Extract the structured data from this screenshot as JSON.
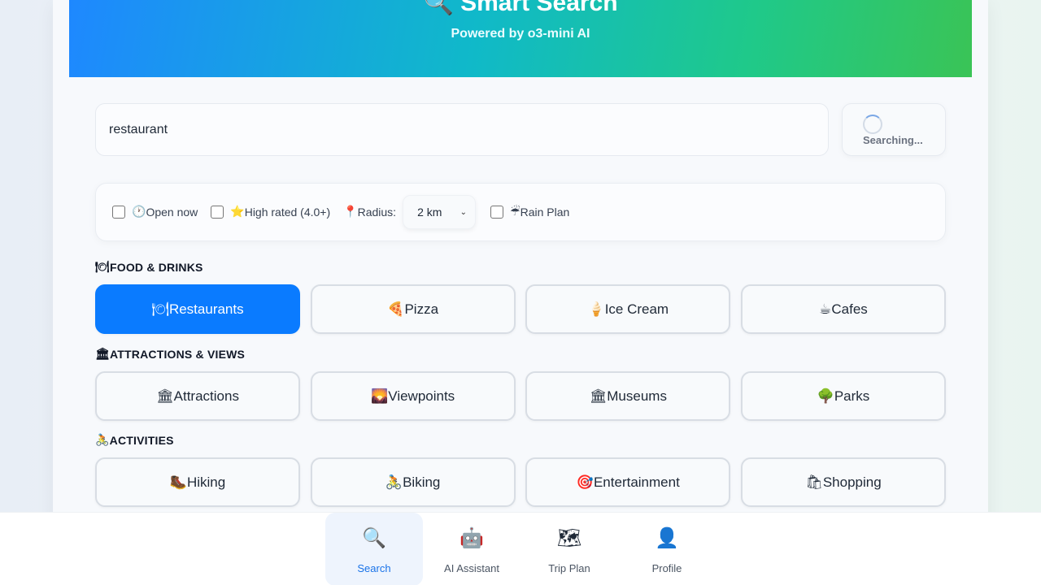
{
  "hero": {
    "title": "🔍 Smart Search",
    "subtitle": "Powered by o3-mini AI",
    "gradient_colors": [
      "#1e88ff",
      "#10b9c9",
      "#3ac456"
    ]
  },
  "search": {
    "value": "restaurant",
    "button_label": "Searching..."
  },
  "filters": {
    "open_now": {
      "icon": "🕐",
      "label": "Open now",
      "checked": false
    },
    "high_rated": {
      "icon": "⭐",
      "label": "High rated (4.0+)",
      "checked": false
    },
    "radius": {
      "icon": "📍",
      "label": "Radius:",
      "selected": "2 km"
    },
    "rain_plan": {
      "icon": "☔",
      "label": "Rain Plan",
      "checked": false
    }
  },
  "sections": [
    {
      "icon": "🍽",
      "title": "FOOD & DRINKS",
      "items": [
        {
          "icon": "🍽",
          "label": "Restaurants",
          "active": true
        },
        {
          "icon": "🍕",
          "label": "Pizza",
          "active": false
        },
        {
          "icon": "🍦",
          "label": "Ice Cream",
          "active": false
        },
        {
          "icon": "☕",
          "label": "Cafes",
          "active": false
        }
      ]
    },
    {
      "icon": "🏛",
      "title": "ATTRACTIONS & VIEWS",
      "items": [
        {
          "icon": "🏛",
          "label": "Attractions",
          "active": false
        },
        {
          "icon": "🌄",
          "label": "Viewpoints",
          "active": false
        },
        {
          "icon": "🏛",
          "label": "Museums",
          "active": false
        },
        {
          "icon": "🌳",
          "label": "Parks",
          "active": false
        }
      ]
    },
    {
      "icon": "🚴",
      "title": "ACTIVITIES",
      "items": [
        {
          "icon": "🥾",
          "label": "Hiking",
          "active": false
        },
        {
          "icon": "🚴",
          "label": "Biking",
          "active": false
        },
        {
          "icon": "🎯",
          "label": "Entertainment",
          "active": false
        },
        {
          "icon": "🛍",
          "label": "Shopping",
          "active": false
        }
      ]
    }
  ],
  "bottom_nav": [
    {
      "icon": "🔍",
      "label": "Search",
      "active": true
    },
    {
      "icon": "🤖",
      "label": "AI Assistant",
      "active": false
    },
    {
      "icon": "🗺",
      "label": "Trip Plan",
      "active": false
    },
    {
      "icon": "👤",
      "label": "Profile",
      "active": false
    }
  ],
  "colors": {
    "accent": "#0a7bff",
    "active_nav_text": "#1a73e8"
  }
}
